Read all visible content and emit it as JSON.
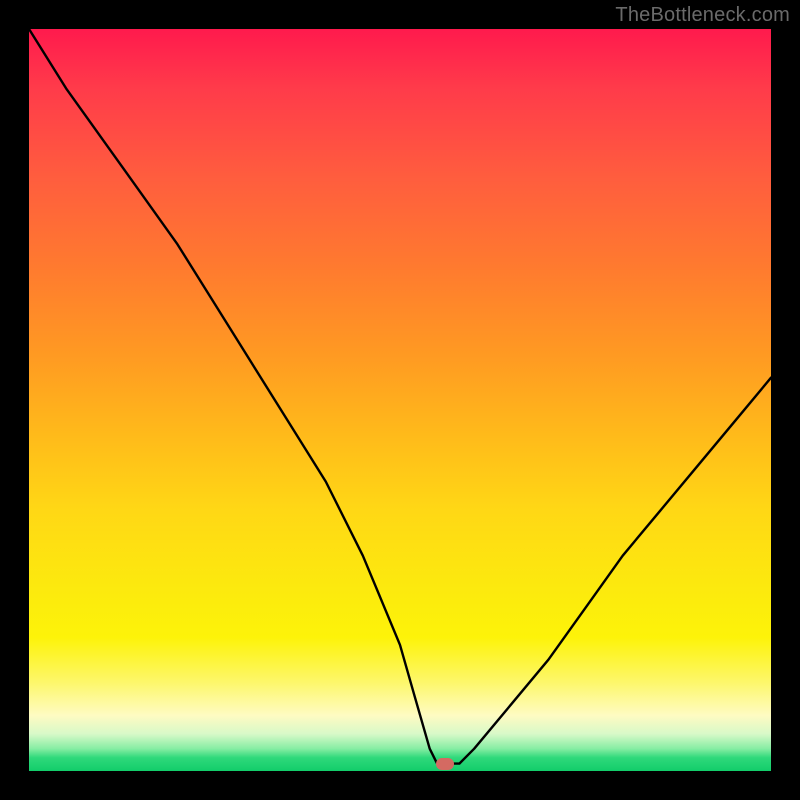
{
  "watermark": "TheBottleneck.com",
  "chart_data": {
    "type": "line",
    "title": "",
    "xlabel": "",
    "ylabel": "",
    "xlim": [
      0,
      100
    ],
    "ylim": [
      0,
      100
    ],
    "grid": false,
    "legend": false,
    "series": [
      {
        "name": "bottleneck-curve",
        "x": [
          0,
          5,
          10,
          15,
          20,
          25,
          30,
          35,
          40,
          45,
          50,
          52,
          54,
          55,
          56,
          58,
          60,
          65,
          70,
          75,
          80,
          85,
          90,
          95,
          100
        ],
        "values": [
          100,
          92,
          85,
          78,
          71,
          63,
          55,
          47,
          39,
          29,
          17,
          10,
          3,
          1,
          1,
          1,
          3,
          9,
          15,
          22,
          29,
          35,
          41,
          47,
          53
        ]
      }
    ],
    "marker": {
      "x": 56,
      "y": 1,
      "label": "optimal-point"
    },
    "background_gradient": {
      "stops": [
        {
          "pos": 0,
          "color": "#ff1a4d"
        },
        {
          "pos": 0.55,
          "color": "#ffbb1a"
        },
        {
          "pos": 0.82,
          "color": "#fdf309"
        },
        {
          "pos": 0.93,
          "color": "#fefbc2"
        },
        {
          "pos": 1.0,
          "color": "#12cd6a"
        }
      ]
    }
  }
}
